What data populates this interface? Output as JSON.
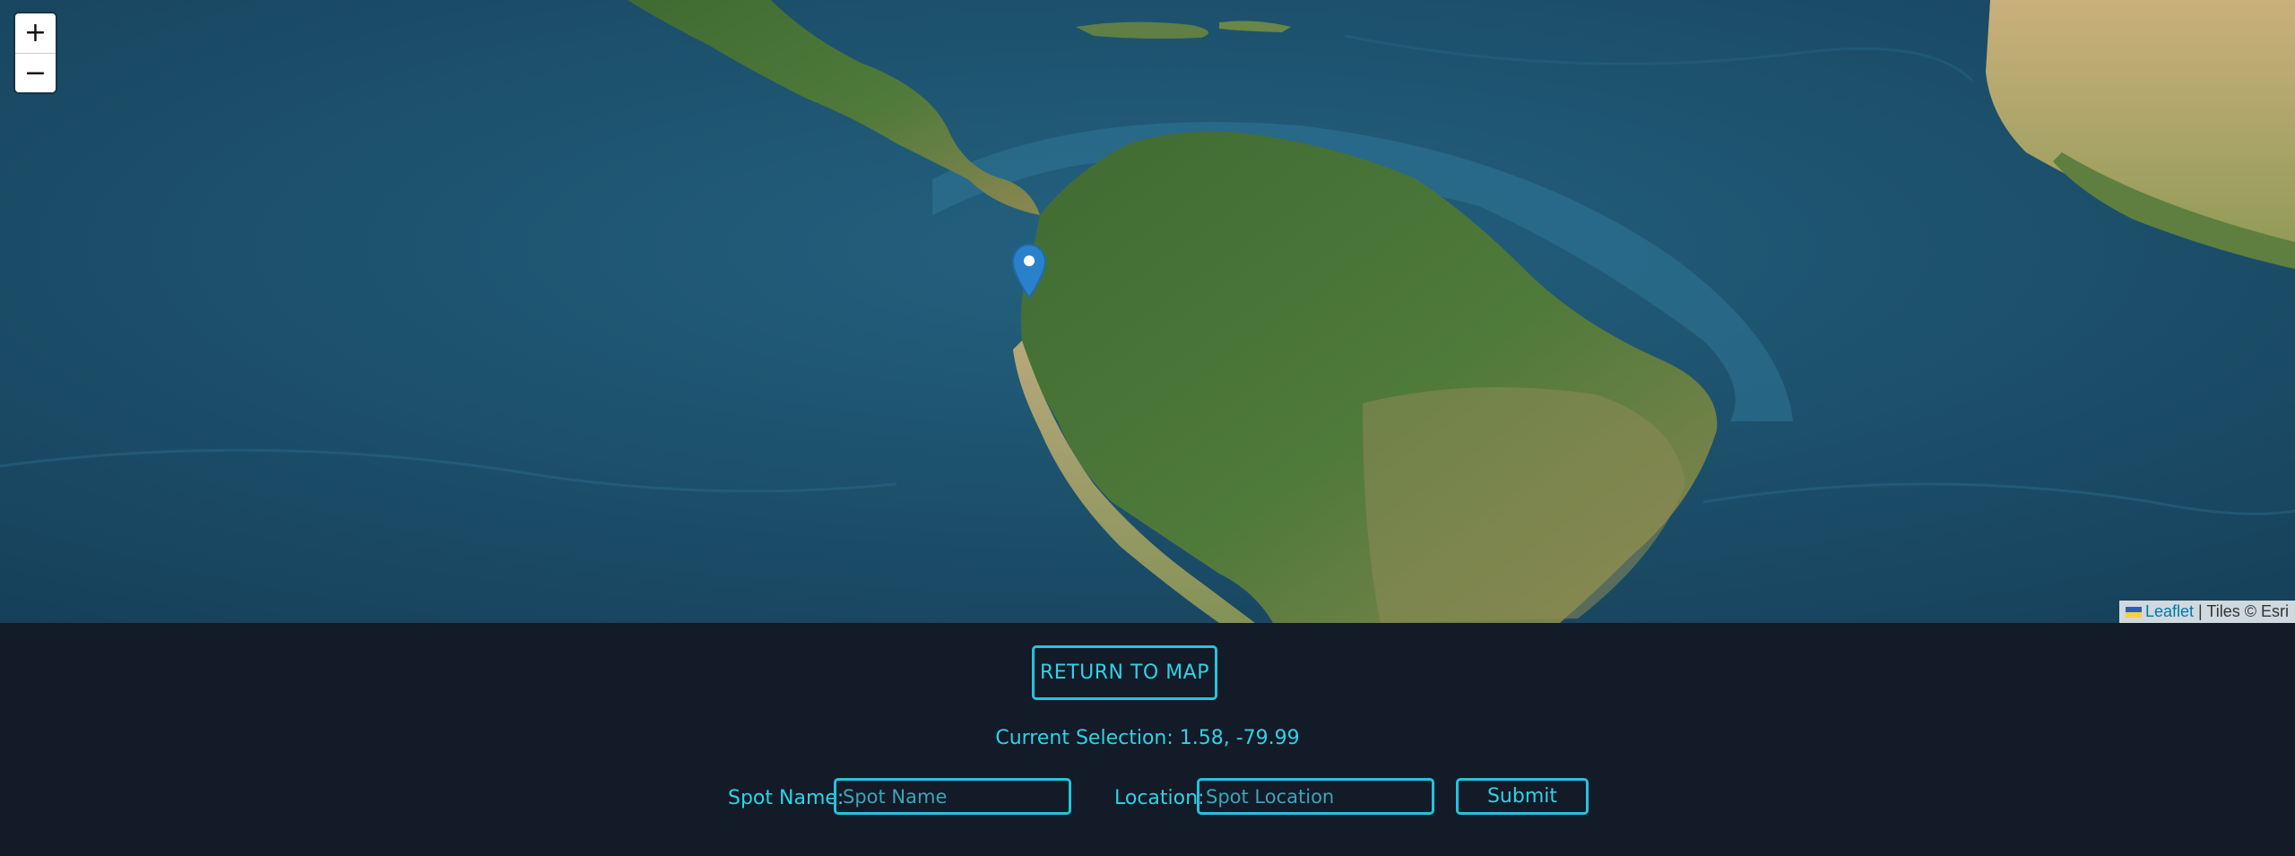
{
  "map": {
    "zoom_in_label": "+",
    "zoom_out_label": "−",
    "marker_icon": "map-pin-icon",
    "marker_color": "#2a81cb",
    "attribution": {
      "link_text": "Leaflet",
      "separator": " | ",
      "tiles_text": "Tiles © Esri"
    }
  },
  "panel": {
    "return_button_label": "RETURN TO MAP",
    "selection_text": "Current Selection: 1.58, -79.99",
    "spot_name_label": "Spot Name:",
    "spot_name_placeholder": "Spot Name",
    "location_label": "Location:",
    "location_placeholder": "Spot Location",
    "submit_label": "Submit",
    "accent_color": "#2ed3e6",
    "background_color": "#131a28"
  }
}
